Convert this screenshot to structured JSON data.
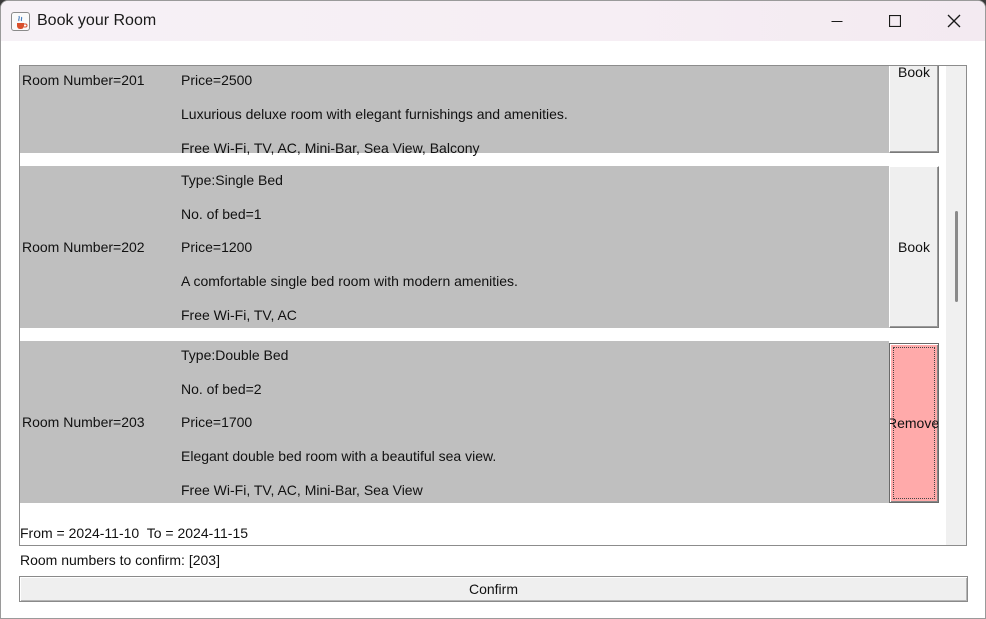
{
  "window": {
    "title": "Book your Room",
    "icon": "java-cup-icon"
  },
  "rooms": [
    {
      "room_number_label": "Room Number=201",
      "details": [
        "Price=2500",
        "Luxurious deluxe room with elegant furnishings and amenities.",
        "Free Wi-Fi, TV, AC, Mini-Bar, Sea View, Balcony"
      ],
      "button_label": "Book"
    },
    {
      "room_number_label": "Room Number=202",
      "details": [
        "Type:Single Bed",
        "No. of bed=1",
        "Price=1200",
        "A comfortable single bed room with modern amenities.",
        "Free Wi-Fi, TV, AC"
      ],
      "button_label": "Book"
    },
    {
      "room_number_label": "Room Number=203",
      "details": [
        "Type:Double Bed",
        "No. of bed=2",
        "Price=1700",
        "Elegant double bed room with a beautiful sea view.",
        "Free Wi-Fi, TV, AC, Mini-Bar, Sea View"
      ],
      "button_label": "Remove"
    }
  ],
  "booking": {
    "dates_label": "From = 2024-11-10  To = 2024-11-15",
    "confirm_list_label": "Room numbers to confirm: [203]",
    "confirm_button": "Confirm"
  },
  "colors": {
    "panel_bg": "#bfbfbf",
    "remove_button_bg": "#ffaaaa",
    "button_bg": "#efefef"
  }
}
